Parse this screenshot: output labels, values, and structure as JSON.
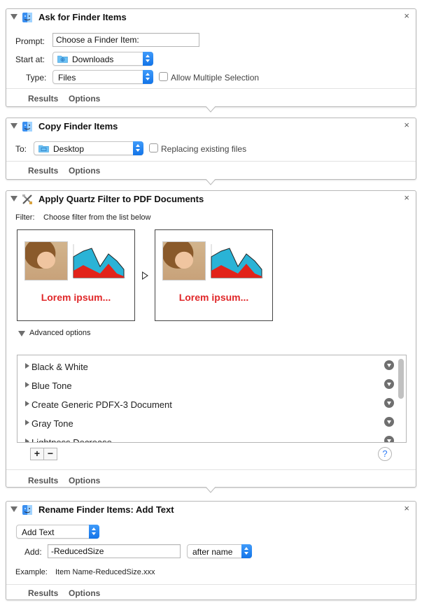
{
  "actions": [
    {
      "title": "Ask for Finder Items",
      "prompt_label": "Prompt:",
      "prompt_value": "Choose a Finder Item:",
      "start_label": "Start at:",
      "start_value": "Downloads",
      "type_label": "Type:",
      "type_value": "Files",
      "multi_label": "Allow Multiple Selection",
      "results": "Results",
      "options": "Options"
    },
    {
      "title": "Copy Finder Items",
      "to_label": "To:",
      "to_value": "Desktop",
      "replace_label": "Replacing existing files",
      "results": "Results",
      "options": "Options"
    },
    {
      "title": "Apply Quartz Filter to PDF Documents",
      "filter_label": "Filter:",
      "filter_hint": "Choose filter from the list below",
      "preview_text_before": "Lorem ipsum...",
      "preview_text_after": "Lorem ipsum...",
      "advanced_label": "Advanced options",
      "filters": [
        "Black & White",
        "Blue Tone",
        "Create Generic PDFX-3 Document",
        "Gray Tone",
        "Lightness Decrease"
      ],
      "plus": "+",
      "minus": "−",
      "help": "?",
      "results": "Results",
      "options": "Options"
    },
    {
      "title": "Rename Finder Items: Add Text",
      "mode_value": "Add Text",
      "add_label": "Add:",
      "add_value": "-ReducedSize",
      "position_value": "after name",
      "example_label": "Example:",
      "example_value": "Item Name-ReducedSize.xxx",
      "results": "Results",
      "options": "Options"
    }
  ],
  "close_glyph": "×",
  "colors": {
    "accent": "#1a7cf0",
    "lorem_red": "#e0282a",
    "chart_cyan": "#2ab3d6",
    "chart_red": "#e2231a"
  }
}
